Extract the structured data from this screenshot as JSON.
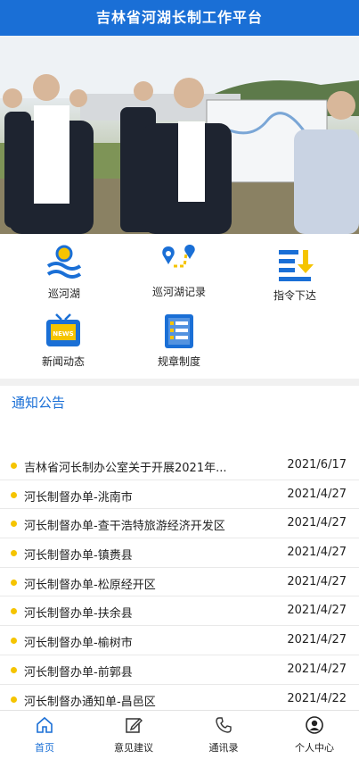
{
  "header": {
    "title": "吉林省河湖长制工作平台"
  },
  "banner": {
    "icon": "river-inspection-photo"
  },
  "menu": [
    {
      "label": "巡河湖",
      "icon": "river-patrol-icon"
    },
    {
      "label": "巡河湖记录",
      "icon": "patrol-record-icon"
    },
    {
      "label": "指令下达",
      "icon": "instruction-icon"
    },
    {
      "label": "新闻动态",
      "icon": "news-icon"
    },
    {
      "label": "规章制度",
      "icon": "regulations-icon"
    }
  ],
  "notices": {
    "title": "通知公告",
    "items": [
      {
        "title": "吉林省河长制办公室关于开展2021年...",
        "date": "2021/6/17"
      },
      {
        "title": "河长制督办单-洮南市",
        "date": "2021/4/27"
      },
      {
        "title": "河长制督办单-查干浩特旅游经济开发区",
        "date": "2021/4/27"
      },
      {
        "title": "河长制督办单-镇赉县",
        "date": "2021/4/27"
      },
      {
        "title": "河长制督办单-松原经开区",
        "date": "2021/4/27"
      },
      {
        "title": "河长制督办单-扶余县",
        "date": "2021/4/27"
      },
      {
        "title": "河长制督办单-榆树市",
        "date": "2021/4/27"
      },
      {
        "title": "河长制督办单-前郭县",
        "date": "2021/4/27"
      },
      {
        "title": "河长制督办通知单-昌邑区",
        "date": "2021/4/22"
      }
    ]
  },
  "tabs": [
    {
      "label": "首页",
      "icon": "home-icon",
      "active": true
    },
    {
      "label": "意见建议",
      "icon": "edit-icon",
      "active": false
    },
    {
      "label": "通讯录",
      "icon": "phone-icon",
      "active": false
    },
    {
      "label": "个人中心",
      "icon": "user-icon",
      "active": false
    }
  ],
  "colors": {
    "primary": "#1a6fd6",
    "accent": "#f5c400"
  }
}
